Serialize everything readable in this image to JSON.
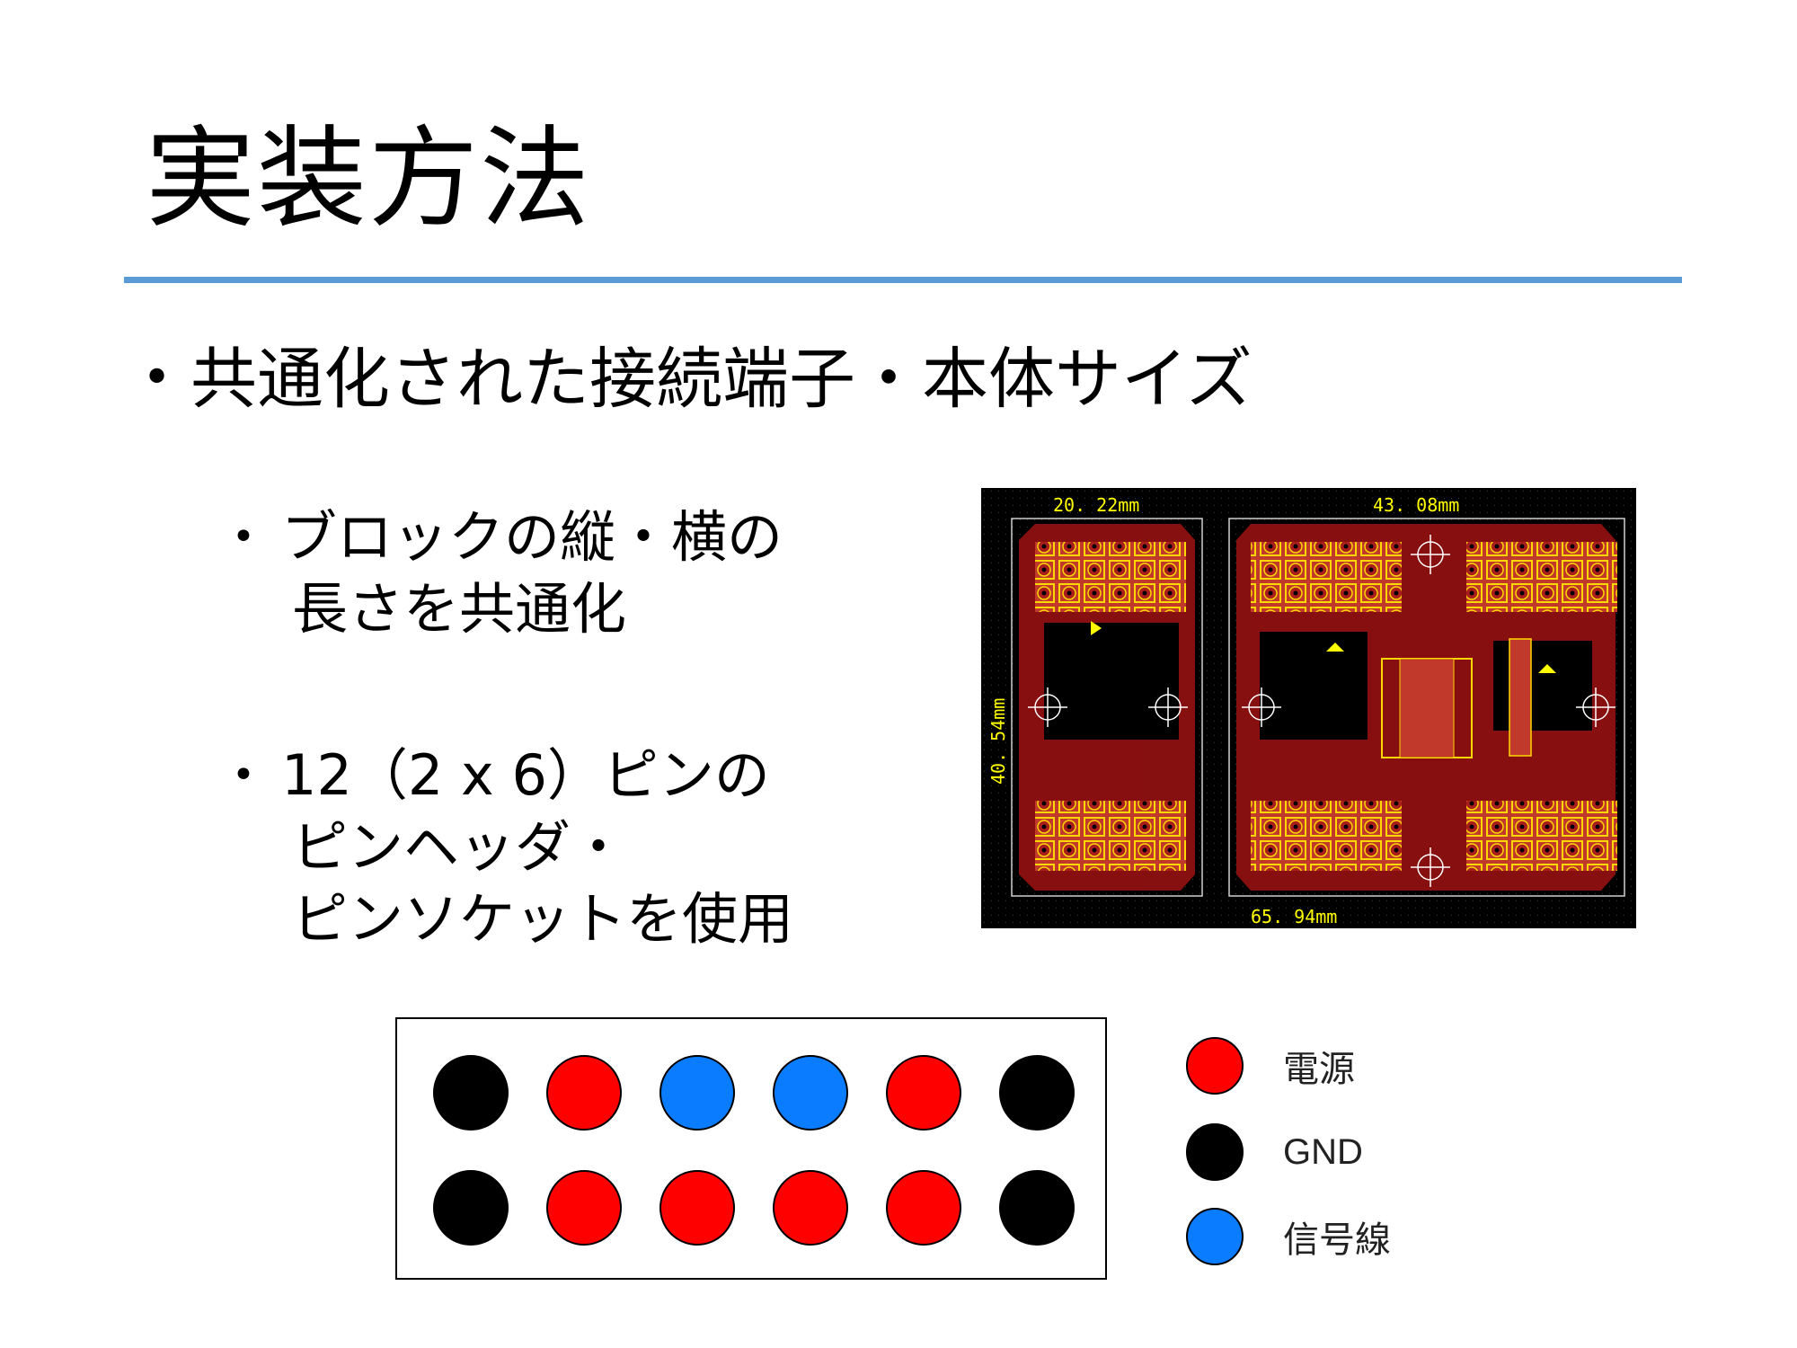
{
  "slide": {
    "title": "実装方法",
    "main_bullet": "共通化された接続端子・本体サイズ",
    "sub_bullets": [
      {
        "lines": [
          "ブロックの縦・横の",
          "長さを共通化"
        ]
      },
      {
        "lines": [
          "12（2 x 6）ピンの",
          "ピンヘッダ・",
          "ピンソケットを使用"
        ]
      }
    ]
  },
  "pcb": {
    "dim_top_left": "20. 22mm",
    "dim_top_right": "43. 08mm",
    "dim_left": "40. 54mm",
    "dim_bottom": "65. 94mm"
  },
  "pinout": {
    "rows": [
      [
        "gnd",
        "power",
        "signal",
        "signal",
        "power",
        "gnd"
      ],
      [
        "gnd",
        "power",
        "power",
        "power",
        "power",
        "gnd"
      ]
    ]
  },
  "legend": [
    {
      "key": "power",
      "label": "電源",
      "color": "#ff0000"
    },
    {
      "key": "gnd",
      "label": "GND",
      "color": "#000000"
    },
    {
      "key": "signal",
      "label": "信号線",
      "color": "#0a7cff"
    }
  ]
}
